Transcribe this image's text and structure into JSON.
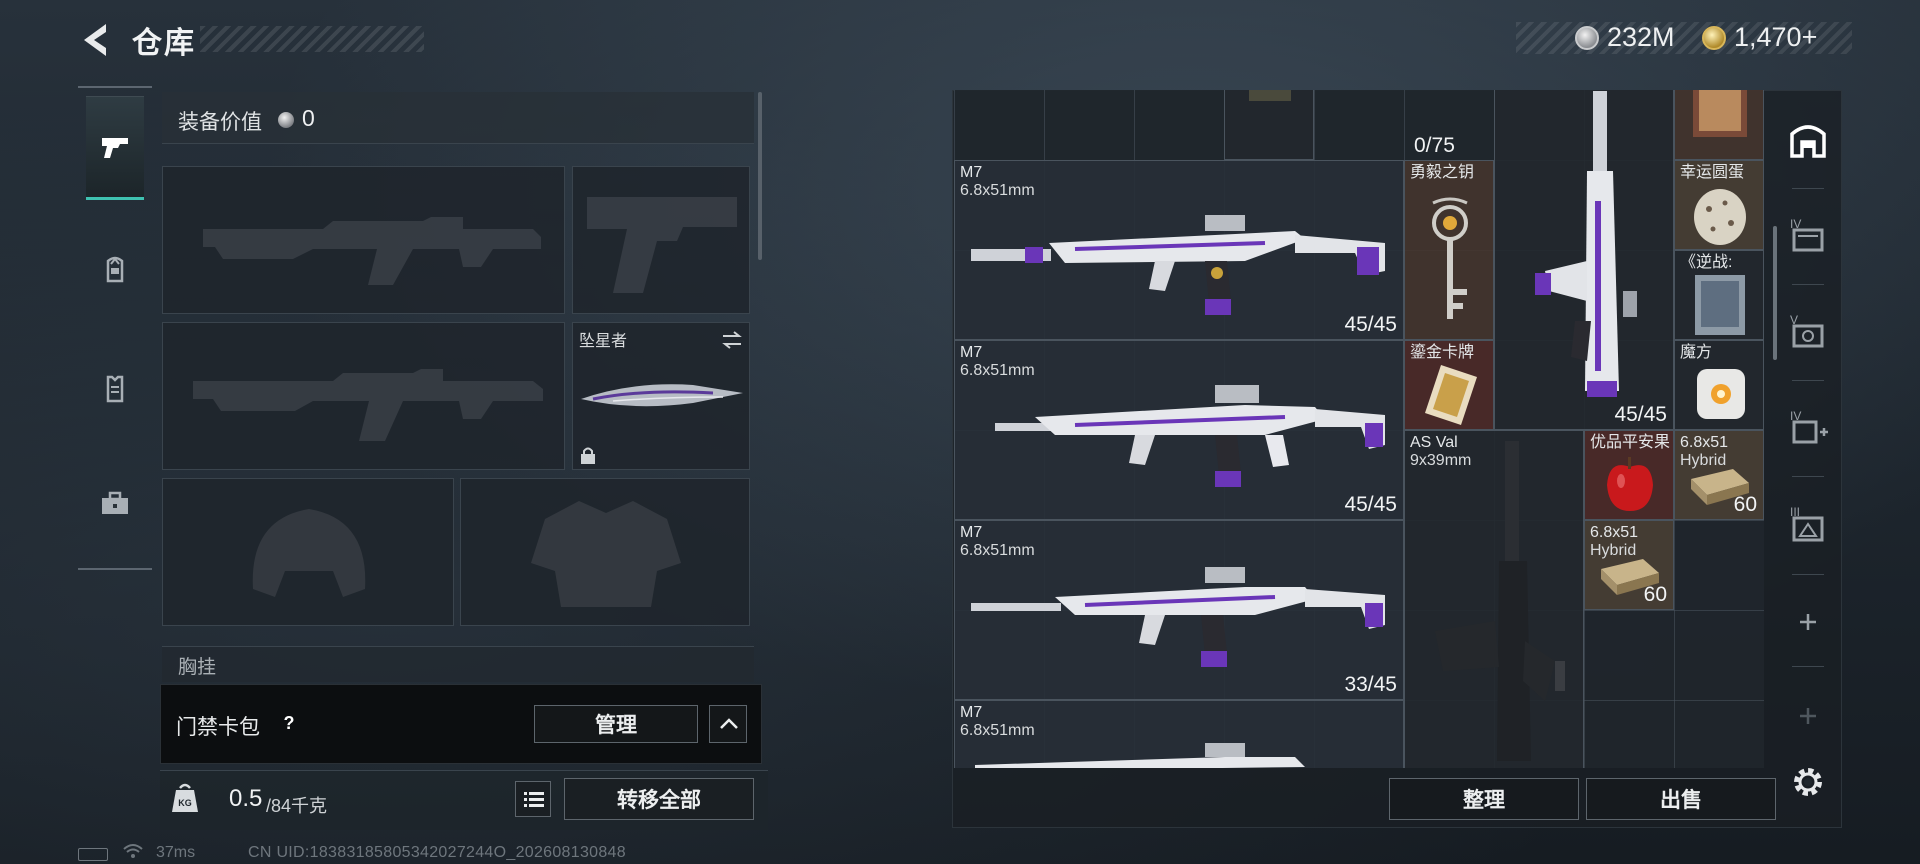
{
  "header": {
    "title": "仓库",
    "currency": [
      {
        "icon": "silver-coin-icon",
        "value": "232M"
      },
      {
        "icon": "gold-coin-icon",
        "value": "1,470"
      }
    ],
    "currency_add": "+"
  },
  "nav": [
    {
      "name": "weapons",
      "icon": "pistol-icon",
      "active": true
    },
    {
      "name": "backpack",
      "icon": "backpack-icon",
      "active": false
    },
    {
      "name": "armor",
      "icon": "vest-icon",
      "active": false
    },
    {
      "name": "supplies",
      "icon": "toolbox-icon",
      "active": false
    }
  ],
  "equipment": {
    "value_label": "装备价值",
    "value": "0",
    "slots": [
      {
        "name": "primary-weapon-1",
        "label": "",
        "empty": true
      },
      {
        "name": "sidearm",
        "label": "",
        "empty": true
      },
      {
        "name": "primary-weapon-2",
        "label": "",
        "empty": true
      },
      {
        "name": "melee",
        "label": "坠星者",
        "empty": false,
        "locked": true
      },
      {
        "name": "helmet",
        "label": "",
        "empty": true
      },
      {
        "name": "body-armor",
        "label": "",
        "empty": true
      }
    ],
    "chest_rig_label": "胸挂"
  },
  "access_card": {
    "label": "门禁卡包",
    "help": "?",
    "manage": "管理"
  },
  "weight": {
    "current": "0.5",
    "max": "/84千克",
    "transfer_all": "转移全部"
  },
  "status": {
    "ping": "37ms",
    "uid": "CN UID:18383185805342027244O_202608130848"
  },
  "inventory": {
    "top_count": "0/75",
    "rifles": [
      {
        "name": "M7",
        "caliber": "6.8x51mm",
        "ammo": "45/45"
      },
      {
        "name": "M7",
        "caliber": "6.8x51mm",
        "ammo": "45/45"
      },
      {
        "name": "M7",
        "caliber": "6.8x51mm",
        "ammo": "33/45"
      },
      {
        "name": "M7",
        "caliber": "6.8x51mm",
        "ammo": ""
      }
    ],
    "vertical_rifle": {
      "ammo": "45/45"
    },
    "as_val": {
      "name": "AS Val",
      "caliber": "9x39mm"
    },
    "items": [
      {
        "name": "勇毅之钥",
        "count": ""
      },
      {
        "name": "鎏金卡牌",
        "count": ""
      },
      {
        "name": "幸运圆蛋",
        "count": ""
      },
      {
        "name": "《逆战:",
        "count": ""
      },
      {
        "name": "魔方",
        "count": ""
      },
      {
        "name": "优品平安果",
        "count": ""
      },
      {
        "name": "6.8x51",
        "sub": "Hybrid",
        "count": "60"
      },
      {
        "name": "6.8x51",
        "sub": "Hybrid",
        "count": "60"
      }
    ],
    "sort": "整理",
    "sell": "出售"
  },
  "side_tabs": [
    {
      "icon": "stash-icon"
    },
    {
      "icon": "container-iv-icon"
    },
    {
      "icon": "container-v-icon"
    },
    {
      "icon": "container-iv-plus-icon"
    },
    {
      "icon": "container-iii-icon"
    },
    {
      "icon": "add-icon"
    },
    {
      "icon": "add-icon-dim"
    },
    {
      "icon": "settings-icon"
    }
  ],
  "colors": {
    "accent": "#3fc2b1",
    "purple": "#6a36b8",
    "panel": "#1f262c"
  }
}
